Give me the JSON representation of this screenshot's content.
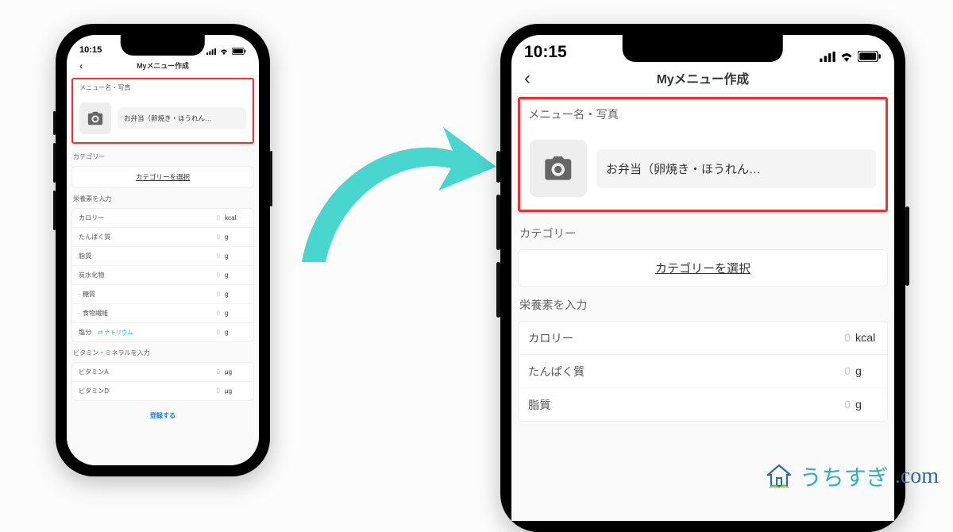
{
  "statusbar": {
    "time": "10:15"
  },
  "navbar": {
    "title": "Myメニュー作成"
  },
  "section_menu_label": "メニュー名・写真",
  "menu_name_value": "お弁当（卵焼き・ほうれん…",
  "section_category_label": "カテゴリー",
  "category_select_label": "カテゴリーを選択",
  "section_nutrition_label": "栄養素を入力",
  "nutrition": [
    {
      "name": "カロリー",
      "value": "0",
      "unit": "kcal"
    },
    {
      "name": "たんぱく質",
      "value": "0",
      "unit": "g"
    },
    {
      "name": "脂質",
      "value": "0",
      "unit": "g"
    },
    {
      "name": "炭水化物",
      "value": "0",
      "unit": "g"
    },
    {
      "name": "糖質",
      "value": "0",
      "unit": "g",
      "sub": true
    },
    {
      "name": "食物繊維",
      "value": "0",
      "unit": "g",
      "sub": true
    },
    {
      "name": "塩分",
      "value": "0",
      "unit": "g",
      "link": "⇄ ナトリウム"
    }
  ],
  "section_vitamin_label": "ビタミン・ミネラルを入力",
  "vitamins": [
    {
      "name": "ビタミンA",
      "value": "0",
      "unit": "μg"
    },
    {
      "name": "ビタミンD",
      "value": "0",
      "unit": "μg"
    }
  ],
  "submit_label": "登録する",
  "watermark": {
    "text": "うちすぎ",
    "domain": ".com"
  }
}
